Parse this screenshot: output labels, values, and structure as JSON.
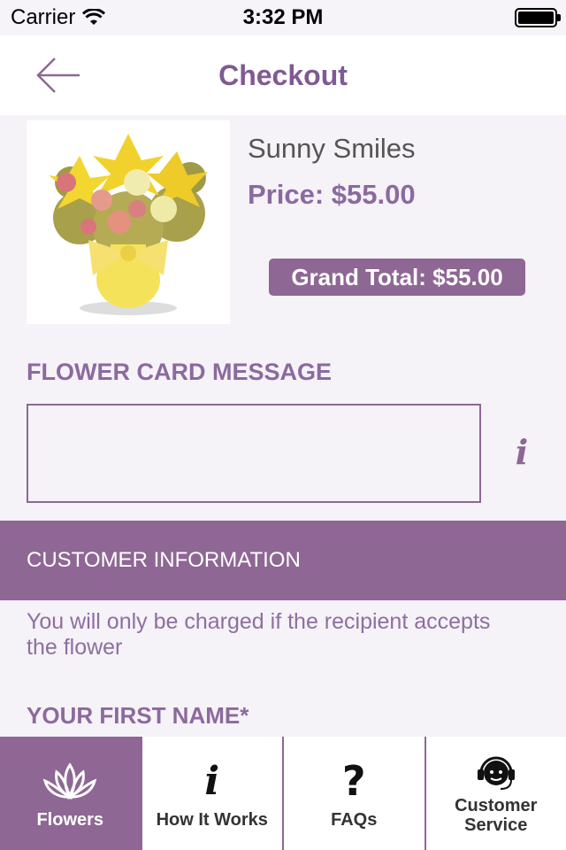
{
  "status": {
    "carrier": "Carrier",
    "time": "3:32 PM"
  },
  "nav": {
    "title": "Checkout"
  },
  "product": {
    "name": "Sunny Smiles",
    "price": "Price: $55.00",
    "grand_total": "Grand Total: $55.00"
  },
  "card": {
    "label": "FLOWER CARD MESSAGE",
    "message_value": "",
    "placeholder": ""
  },
  "customer": {
    "banner": "CUSTOMER INFORMATION",
    "note": "You will only be charged if the recipient accepts the flower",
    "first_name_label": "YOUR FIRST NAME*"
  },
  "tabs": [
    {
      "label": "Flowers",
      "icon": "lotus-icon",
      "active": true
    },
    {
      "label": "How It Works",
      "icon": "info-icon",
      "active": false
    },
    {
      "label": "FAQs",
      "icon": "question-icon",
      "active": false
    },
    {
      "label": "Customer Service",
      "icon": "headset-icon",
      "active": false
    }
  ],
  "colors": {
    "accent": "#8e6794",
    "title": "#7f5a93",
    "background": "#f5f2f8"
  }
}
